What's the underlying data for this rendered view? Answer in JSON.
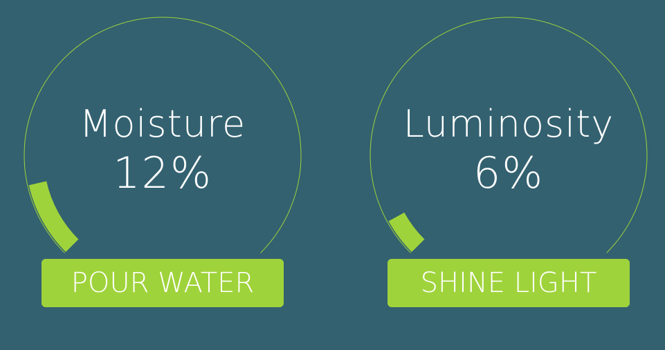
{
  "colors": {
    "background": "#336170",
    "accent": "#9fd33b",
    "text": "#ffffff"
  },
  "gauges": [
    {
      "label": "Moisture",
      "value_text": "12%",
      "value": 12,
      "button_label": "POUR WATER"
    },
    {
      "label": "Luminosity",
      "value_text": "6%",
      "value": 6,
      "button_label": "SHINE LIGHT"
    }
  ]
}
